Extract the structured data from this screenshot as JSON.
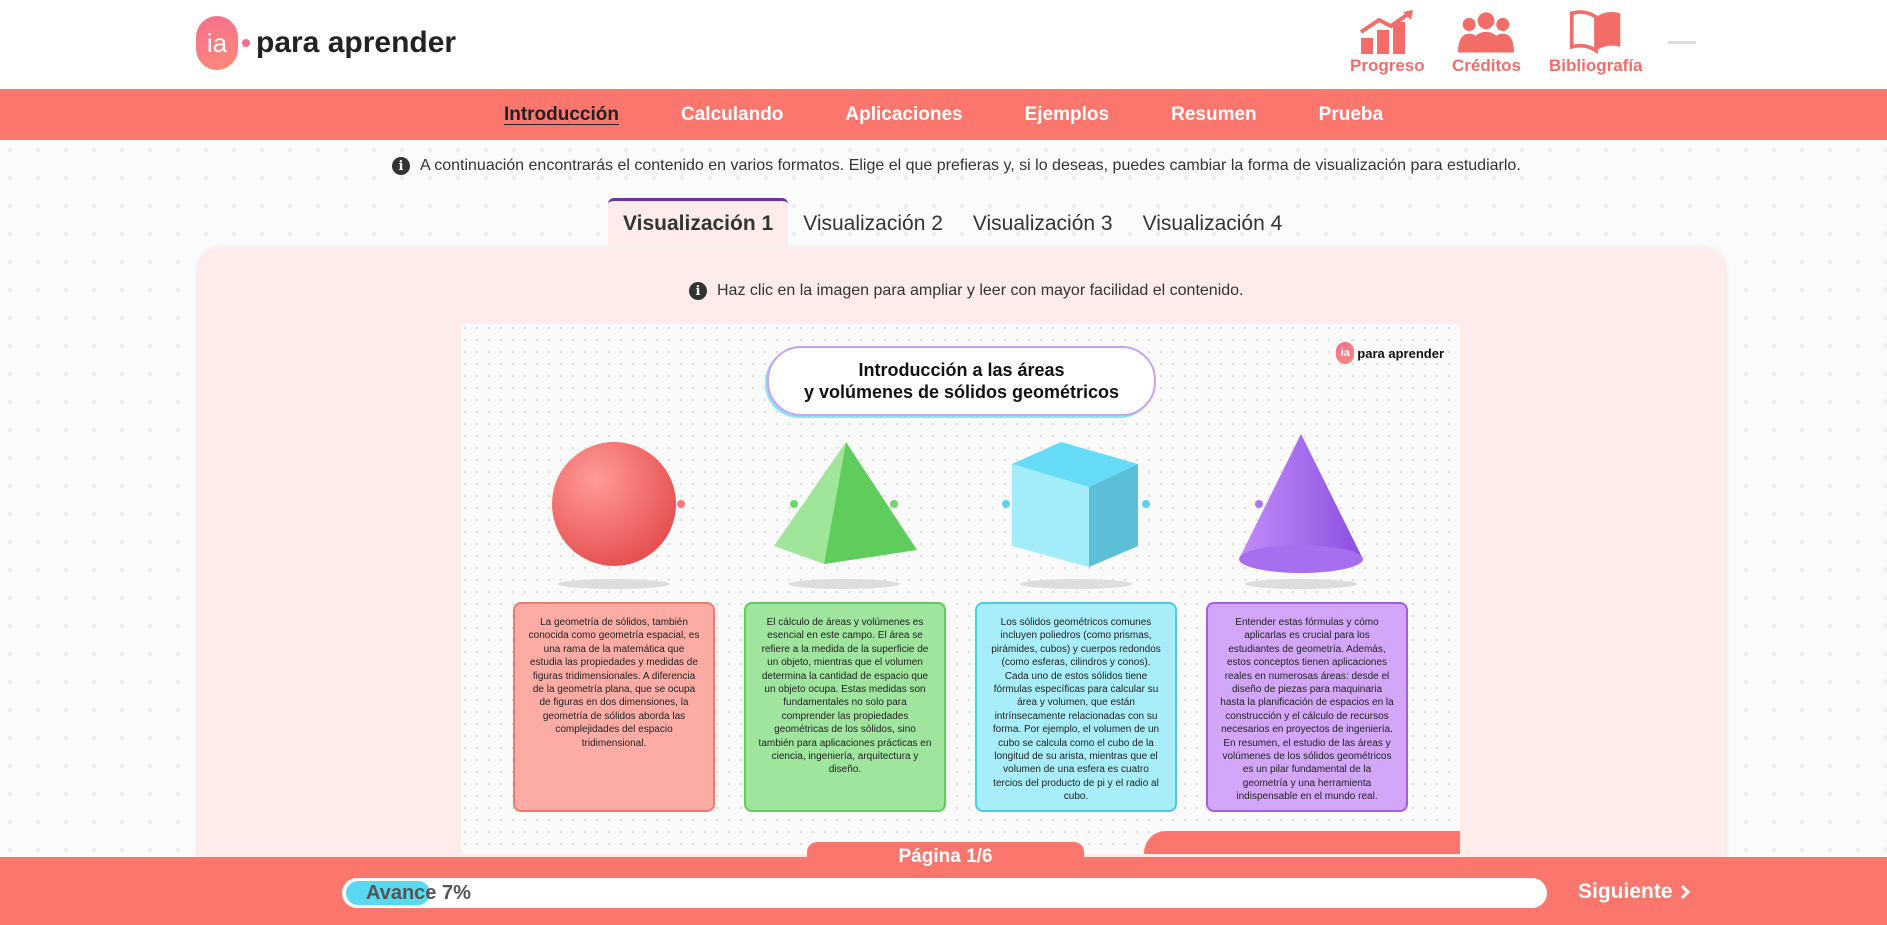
{
  "brand": {
    "badge": "ia",
    "name": "para aprender"
  },
  "top_nav": [
    {
      "label": "Progreso",
      "icon": "chart-growth-icon"
    },
    {
      "label": "Créditos",
      "icon": "group-icon"
    },
    {
      "label": "Bibliografía",
      "icon": "open-book-icon"
    }
  ],
  "main_nav": [
    "Introducción",
    "Calculando",
    "Aplicaciones",
    "Ejemplos",
    "Resumen",
    "Prueba"
  ],
  "main_nav_active": "Introducción",
  "notice": "A continuación encontrarás el contenido en varios formatos. Elige el que prefieras y, si lo deseas, puedes cambiar la forma de visualización para estudiarlo.",
  "tabs": [
    "Visualización 1",
    "Visualización 2",
    "Visualización 3",
    "Visualización 4"
  ],
  "active_tab": "Visualización 1",
  "panel_notice": "Haz clic en la imagen para ampliar y leer con mayor facilidad el contenido.",
  "infographic": {
    "title_line1": "Introducción a las áreas",
    "title_line2": "y volúmenes de sólidos geométricos",
    "logo_badge": "ia",
    "logo_text": "para aprender",
    "cards": [
      "La geometría de sólidos, también conocida como geometría espacial, es una rama de la matemática que estudia las propiedades y medidas de figuras tridimensionales. A diferencia de la geometría plana, que se ocupa de figuras en dos dimensiones, la geometría de sólidos aborda las complejidades del espacio tridimensional.",
      "El cálculo de áreas y volúmenes es esencial en este campo. El área se refiere a la medida de la superficie de un objeto, mientras que el volumen determina la cantidad de espacio que un objeto ocupa. Estas medidas son fundamentales no solo para comprender las propiedades geométricas de los sólidos, sino también para aplicaciones prácticas en ciencia, ingeniería, arquitectura y diseño.",
      "Los sólidos geométricos comunes incluyen poliedros (como prismas, pirámides, cubos) y cuerpos redondos (como esferas, cilindros y conos). Cada uno de estos sólidos tiene fórmulas específicas para calcular su área y volumen, que están intrínsecamente relacionadas con su forma. Por ejemplo, el volumen de un cubo se calcula como el cubo de la longitud de su arista, mientras que el volumen de una esfera es cuatro tercios del producto de pi y el radio al cubo.",
      "Entender estas fórmulas y cómo aplicarlas es crucial para los estudiantes de geometría. Además, estos conceptos tienen aplicaciones reales en numerosas áreas: desde el diseño de piezas para maquinaria hasta la planificación de espacios en la construcción y el cálculo de recursos necesarios en proyectos de ingeniería. En resumen, el estudio de las áreas y volúmenes de los sólidos geométricos es un pilar fundamental de la geometría y una herramienta indispensable en el mundo real."
    ]
  },
  "pager": "Página 1/6",
  "progress": {
    "label": "Avance 7%",
    "value": 7
  },
  "next_label": "Siguiente",
  "colors": {
    "accent": "#fb776d",
    "progress": "#5ad8f1",
    "tab_border": "#6a33a8"
  }
}
